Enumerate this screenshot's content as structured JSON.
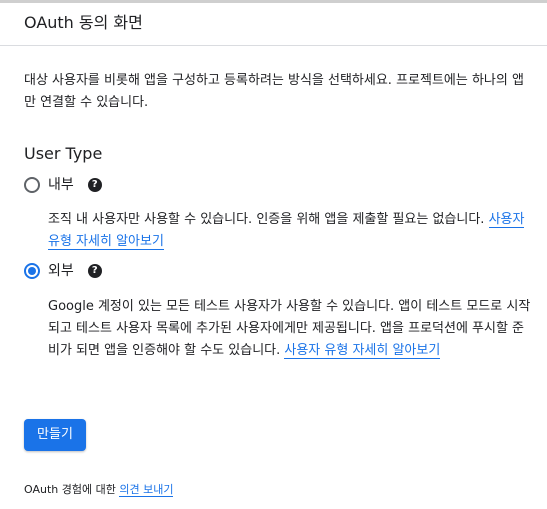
{
  "header": {
    "title": "OAuth 동의 화면"
  },
  "description": "대상 사용자를 비롯해 앱을 구성하고 등록하려는 방식을 선택하세요. 프로젝트에는 하나의 앱만 연결할 수 있습니다.",
  "user_type": {
    "title": "User Type",
    "options": [
      {
        "label": "내부",
        "selected": false,
        "help_icon": "question-circle-icon",
        "description": "조직 내 사용자만 사용할 수 있습니다. 인증을 위해 앱을 제출할 필요는 없습니다.",
        "link": "사용자 유형 자세히 알아보기"
      },
      {
        "label": "외부",
        "selected": true,
        "help_icon": "question-circle-icon",
        "description": "Google 계정이 있는 모든 테스트 사용자가 사용할 수 있습니다. 앱이 테스트 모드로 시작되고 테스트 사용자 목록에 추가된 사용자에게만 제공됩니다. 앱을 프로덕션에 푸시할 준비가 되면 앱을 인증해야 할 수도 있습니다.",
        "link": "사용자 유형 자세히 알아보기"
      }
    ]
  },
  "create_button": {
    "label": "만들기"
  },
  "feedback": {
    "text": "OAuth 경험에 대한",
    "link": "의견 보내기"
  },
  "colors": {
    "accent": "#1a73e8",
    "text": "#202124",
    "divider": "#dadce0"
  },
  "help_glyph": "?"
}
